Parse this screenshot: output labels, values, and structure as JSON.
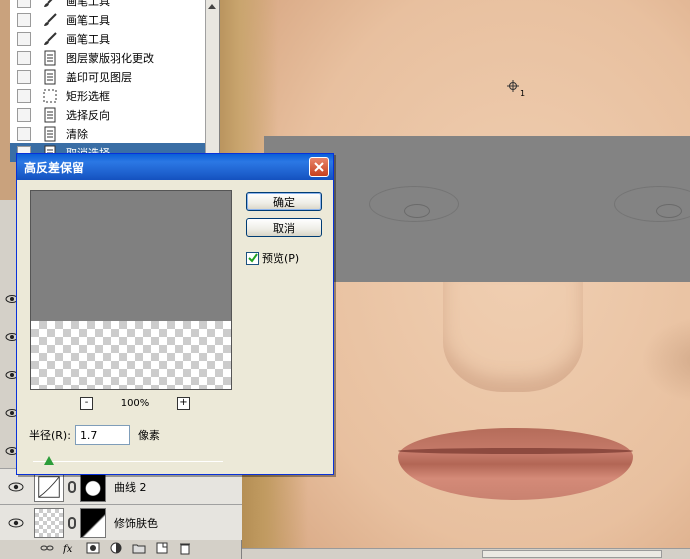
{
  "history": {
    "items": [
      {
        "label": "画笔工具",
        "icon": "brush-icon"
      },
      {
        "label": "画笔工具",
        "icon": "brush-icon"
      },
      {
        "label": "画笔工具",
        "icon": "brush-icon"
      },
      {
        "label": "图层蒙版羽化更改",
        "icon": "document-icon"
      },
      {
        "label": "盖印可见图层",
        "icon": "document-icon"
      },
      {
        "label": "矩形选框",
        "icon": "marquee-icon"
      },
      {
        "label": "选择反向",
        "icon": "document-icon"
      },
      {
        "label": "清除",
        "icon": "document-icon"
      },
      {
        "label": "取消选择",
        "icon": "document-icon"
      }
    ]
  },
  "dialog": {
    "title": "高反差保留",
    "ok_label": "确定",
    "cancel_label": "取消",
    "preview_label": "预览(P)",
    "preview_checked": true,
    "zoom_minus": "-",
    "zoom_plus": "+",
    "zoom_value": "100%",
    "radius_label": "半径(R):",
    "radius_value": "1.7",
    "radius_unit": "像素",
    "slider_fraction": 0.06
  },
  "layers": {
    "items": [
      {
        "name": "曲线 2"
      },
      {
        "name": "修饰肤色"
      }
    ]
  },
  "canvas": {
    "cursor_subscript": "1"
  },
  "colors": {
    "title_bar": "#1f63d0",
    "dialog_bg": "#ece9d8",
    "highpass_gray": "#838383",
    "slider_knob": "#2c9d3a"
  }
}
